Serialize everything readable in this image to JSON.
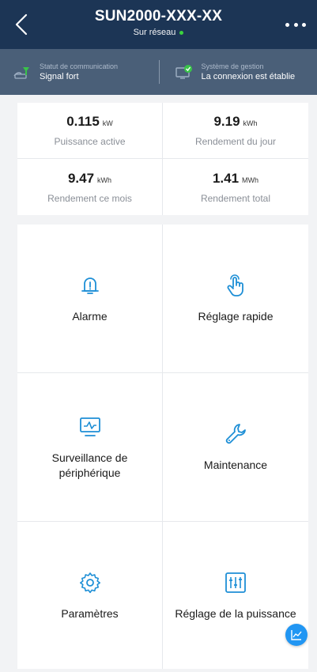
{
  "header": {
    "title": "SUN2000-XXX-XX",
    "subtitle": "Sur réseau",
    "status_color": "#3ddc3d",
    "background": "#1c3555"
  },
  "status_bar": {
    "communication": {
      "label": "Statut de communication",
      "value": "Signal fort",
      "icon": "signal-icon"
    },
    "management": {
      "label": "Système de gestion",
      "value": "La connexion est établie",
      "icon": "monitor-check-icon"
    }
  },
  "metrics": [
    {
      "value": "0.115",
      "unit": "kW",
      "label": "Puissance active"
    },
    {
      "value": "9.19",
      "unit": "kWh",
      "label": "Rendement du jour"
    },
    {
      "value": "9.47",
      "unit": "kWh",
      "label": "Rendement ce mois"
    },
    {
      "value": "1.41",
      "unit": "MWh",
      "label": "Rendement total"
    }
  ],
  "functions": [
    {
      "label": "Alarme",
      "icon": "bell-alert-icon"
    },
    {
      "label": "Réglage rapide",
      "icon": "hand-pointer-icon"
    },
    {
      "label": "Surveillance de périphérique",
      "icon": "monitor-chart-icon"
    },
    {
      "label": "Maintenance",
      "icon": "wrench-icon"
    },
    {
      "label": "Paramètres",
      "icon": "gear-icon"
    },
    {
      "label": "Réglage de la puissance",
      "icon": "sliders-icon"
    }
  ],
  "accent_color": "#1e8fd6",
  "fab_icon": "trend-chart-icon"
}
